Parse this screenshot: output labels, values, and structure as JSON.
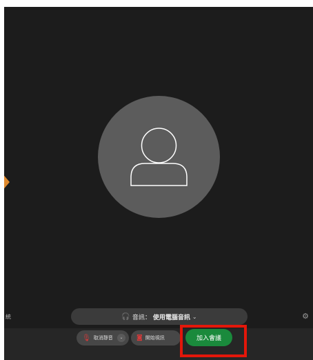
{
  "preview": {
    "avatar_icon": "user-silhouette-icon"
  },
  "left_edge": {
    "label": "統"
  },
  "audio": {
    "icon": "headset-icon",
    "label": "音訊：",
    "value": "使用電腦音訊",
    "chevron": "⌄"
  },
  "controls": {
    "unmute_label": "取消靜音",
    "unmute_chevron": "⌄",
    "video_label": "開始視訊",
    "join_label": "加入會議"
  },
  "colors": {
    "background": "#1c1c1c",
    "join_button": "#1a8a3c",
    "mic_off": "#d23a3a",
    "highlight": "#e3170a",
    "arrow": "#e08a2e"
  },
  "icons": {
    "settings": "gear-icon",
    "mic": "mic-off-icon",
    "camera": "camera-off-icon"
  }
}
